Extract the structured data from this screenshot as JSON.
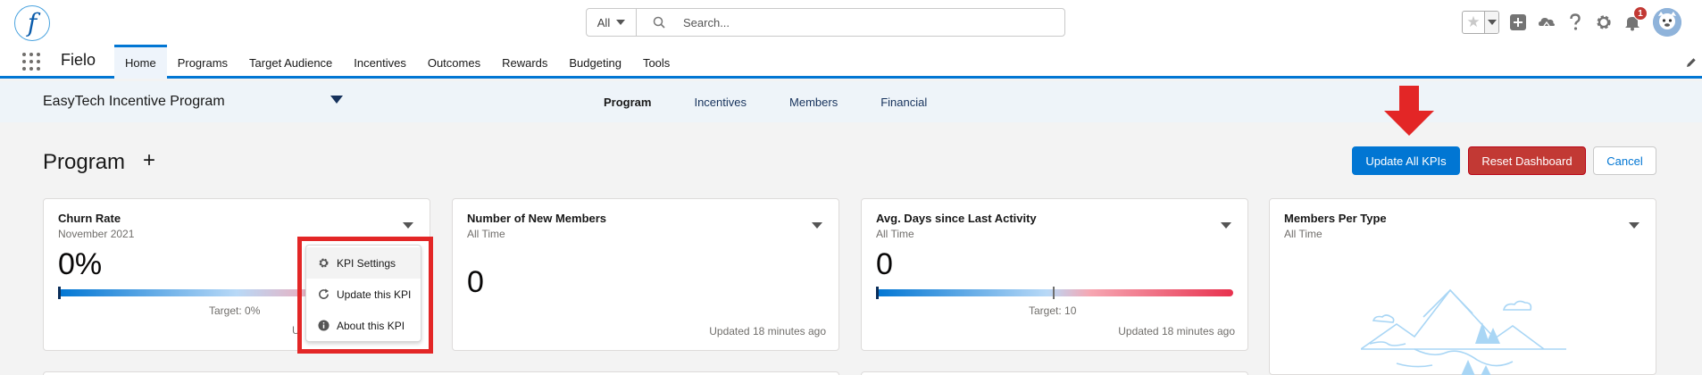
{
  "header": {
    "logo_letter": "f",
    "search": {
      "scope": "All",
      "placeholder": "Search..."
    },
    "notifications_count": "1"
  },
  "nav": {
    "app_name": "Fielo",
    "items": [
      {
        "label": "Home",
        "active": true
      },
      {
        "label": "Programs"
      },
      {
        "label": "Target Audience"
      },
      {
        "label": "Incentives"
      },
      {
        "label": "Outcomes"
      },
      {
        "label": "Rewards"
      },
      {
        "label": "Budgeting"
      },
      {
        "label": "Tools"
      }
    ]
  },
  "subheader": {
    "program": "EasyTech Incentive Program",
    "tabs": [
      {
        "label": "Program",
        "active": true
      },
      {
        "label": "Incentives"
      },
      {
        "label": "Members"
      },
      {
        "label": "Financial"
      }
    ]
  },
  "dashboard": {
    "title": "Program",
    "add_symbol": "+",
    "buttons": {
      "update_all": "Update All KPIs",
      "reset": "Reset Dashboard",
      "cancel": "Cancel"
    }
  },
  "cards": [
    {
      "title": "Churn Rate",
      "subtitle": "November 2021",
      "value": "0%",
      "target_label": "Target: 0%",
      "updated_partial": "U"
    },
    {
      "title": "Number of New Members",
      "subtitle": "All Time",
      "value": "0",
      "updated": "Updated 18 minutes ago"
    },
    {
      "title": "Avg. Days since Last Activity",
      "subtitle": "All Time",
      "value": "0",
      "target_label": "Target: 10",
      "updated": "Updated 18 minutes ago"
    },
    {
      "title": "Members Per Type",
      "subtitle": "All Time"
    }
  ],
  "kpi_menu": {
    "items": [
      {
        "label": "KPI Settings",
        "icon": "gear-icon"
      },
      {
        "label": "Update this KPI",
        "icon": "refresh-icon"
      },
      {
        "label": "About this KPI",
        "icon": "info-icon"
      }
    ]
  },
  "colors": {
    "brand_blue": "#0176d3",
    "destructive_red": "#c23934",
    "annotation_red": "#e32626"
  }
}
